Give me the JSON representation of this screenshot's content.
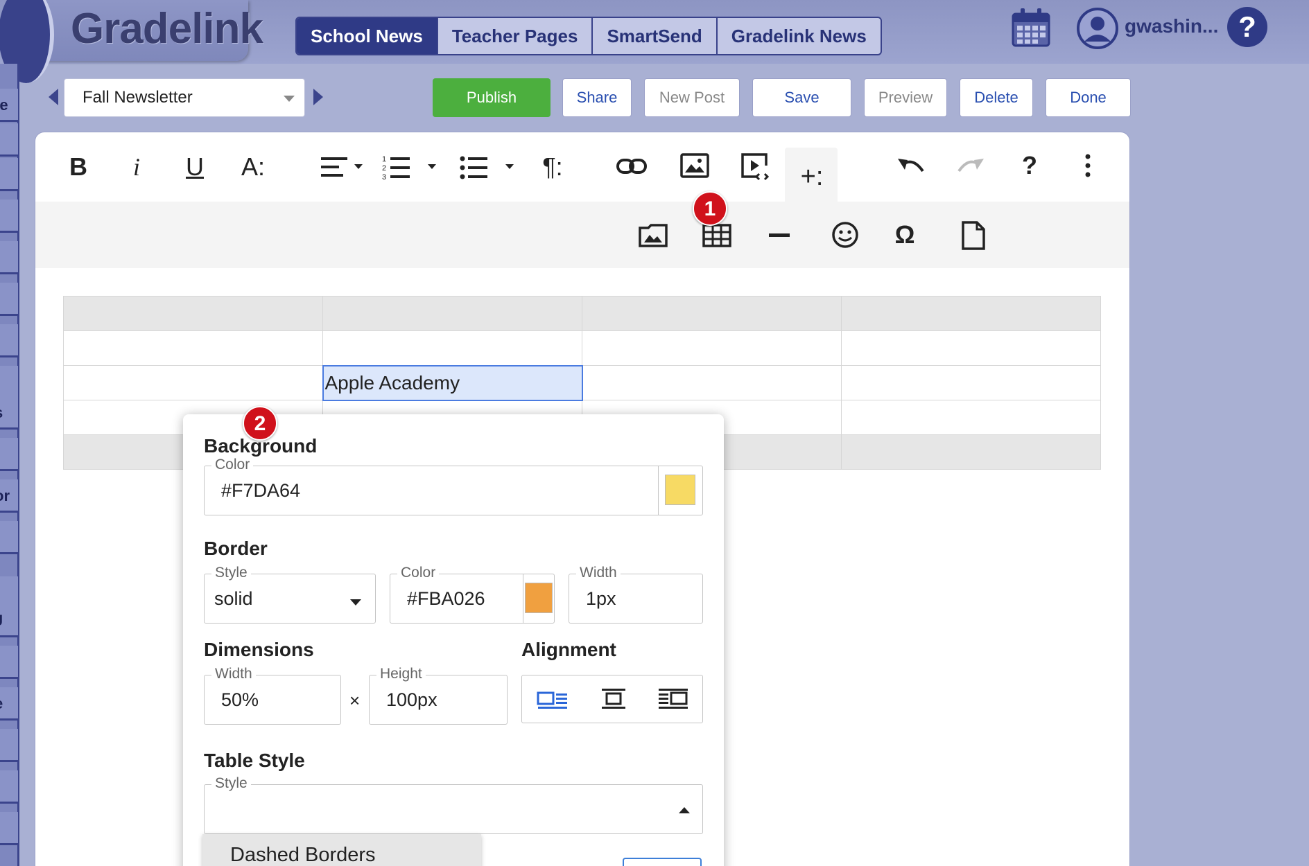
{
  "app": {
    "logo": "Gradelink"
  },
  "nav": {
    "tabs": [
      {
        "label": "School News",
        "active": true
      },
      {
        "label": "Teacher Pages",
        "active": false
      },
      {
        "label": "SmartSend",
        "active": false
      },
      {
        "label": "Gradelink News",
        "active": false
      }
    ]
  },
  "user": {
    "name": "gwashin...",
    "icons": [
      "calendar-icon",
      "user-avatar-icon",
      "help-icon"
    ]
  },
  "sidebar": {
    "labels": [
      "te",
      "s",
      "t",
      "or",
      "J",
      "e"
    ]
  },
  "post_toolbar": {
    "document": "Fall Newsletter",
    "buttons": {
      "publish": "Publish",
      "share": "Share",
      "new_post": "New Post",
      "save": "Save",
      "preview": "Preview",
      "delete": "Delete",
      "done": "Done"
    },
    "disabled": [
      "New Post",
      "Preview"
    ]
  },
  "editor_toolbar": {
    "row1": {
      "bold": "B",
      "italic": "i",
      "underline": "U",
      "font_size": "A:",
      "paragraph": "¶:",
      "more_insert": "+:",
      "help": "?"
    },
    "row1_icons": [
      "bold-icon",
      "italic-icon",
      "underline-icon",
      "font-size-icon",
      "align-icon",
      "ordered-list-icon",
      "unordered-list-icon",
      "paragraph-format-icon",
      "link-icon",
      "image-icon",
      "video-icon",
      "more-insert-icon",
      "undo-icon",
      "redo-icon",
      "help-icon",
      "more-options-icon"
    ],
    "row2_icons": [
      "file-manager-icon",
      "table-icon",
      "horizontal-line-icon",
      "emoticon-icon",
      "special-characters-icon",
      "file-icon"
    ],
    "row2": {
      "omega": "Ω"
    }
  },
  "annotations": {
    "badge1": "1",
    "badge2": "2"
  },
  "table": {
    "rows": [
      [
        "",
        "",
        "",
        ""
      ],
      [
        "",
        "",
        "",
        ""
      ],
      [
        "",
        "Apple Academy",
        "",
        ""
      ],
      [
        "",
        "",
        "",
        ""
      ],
      [
        "",
        "",
        "",
        ""
      ]
    ],
    "selected_cell_text": "Apple Academy"
  },
  "table_props": {
    "background": {
      "title": "Background",
      "color_label": "Color",
      "color_value": "#F7DA64",
      "swatch": "#F7DA64"
    },
    "border": {
      "title": "Border",
      "style_label": "Style",
      "style_value": "solid",
      "color_label": "Color",
      "color_value": "#FBA026",
      "swatch": "#F0A040",
      "width_label": "Width",
      "width_value": "1px"
    },
    "dimensions": {
      "title": "Dimensions",
      "width_label": "Width",
      "width_value": "50%",
      "times": "×",
      "height_label": "Height",
      "height_value": "100px"
    },
    "alignment": {
      "title": "Alignment",
      "options": [
        "align-left-icon",
        "align-center-icon",
        "align-right-icon"
      ]
    },
    "table_style": {
      "title": "Table Style",
      "style_label": "Style",
      "style_value": "",
      "options": [
        "Dashed Borders"
      ]
    }
  },
  "colors": {
    "accent": "#2F3A86",
    "publish": "#4CAF3E",
    "badge": "#D0111B",
    "selection": "#DCE7FB"
  }
}
